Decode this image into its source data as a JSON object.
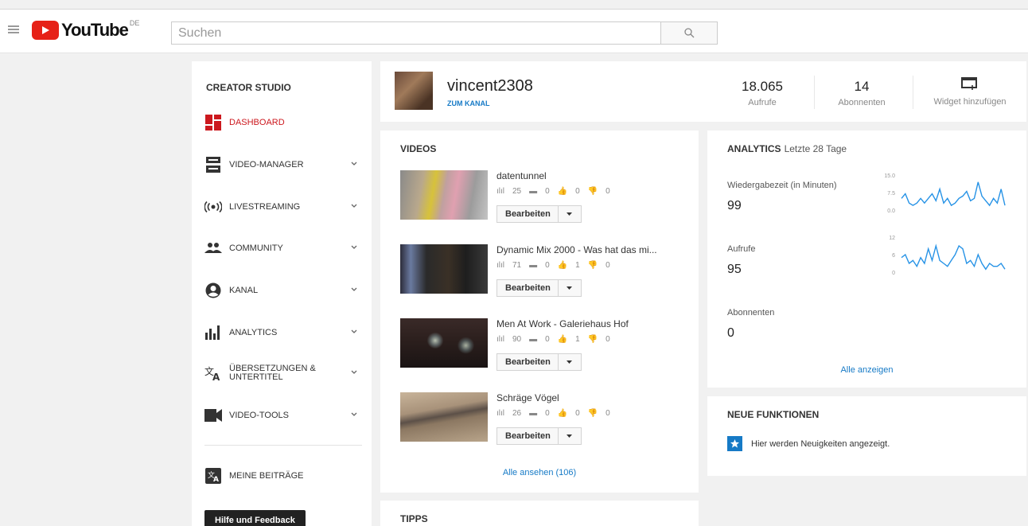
{
  "header": {
    "logo_text": "YouTube",
    "region": "DE",
    "search_placeholder": "Suchen"
  },
  "sidebar": {
    "title": "CREATOR STUDIO",
    "items": [
      {
        "label": "DASHBOARD",
        "icon": "dashboard-icon",
        "active": true
      },
      {
        "label": "VIDEO-MANAGER",
        "icon": "video-manager-icon"
      },
      {
        "label": "LIVESTREAMING",
        "icon": "livestream-icon"
      },
      {
        "label": "COMMUNITY",
        "icon": "community-icon"
      },
      {
        "label": "KANAL",
        "icon": "channel-icon"
      },
      {
        "label": "ANALYTICS",
        "icon": "analytics-icon"
      },
      {
        "label": "ÜBERSETZUNGEN &",
        "label2": "UNTERTITEL",
        "icon": "translate-icon"
      },
      {
        "label": "VIDEO-TOOLS",
        "icon": "video-tools-icon"
      }
    ],
    "contributions_label": "MEINE BEITRÄGE",
    "help_label": "Hilfe und Feedback"
  },
  "channel": {
    "name": "vincent2308",
    "link_label": "ZUM KANAL",
    "stats": [
      {
        "value": "18.065",
        "label": "Aufrufe"
      },
      {
        "value": "14",
        "label": "Abonnenten"
      }
    ],
    "widget_label": "Widget hinzufügen"
  },
  "videos": {
    "title": "VIDEOS",
    "edit_label": "Bearbeiten",
    "items": [
      {
        "title": "datentunnel",
        "views": "25",
        "comments": "0",
        "likes": "0",
        "dislikes": "0"
      },
      {
        "title": "Dynamic Mix 2000 - Was hat das mi...",
        "views": "71",
        "comments": "0",
        "likes": "1",
        "dislikes": "0"
      },
      {
        "title": "Men At Work - Galeriehaus Hof",
        "views": "90",
        "comments": "0",
        "likes": "1",
        "dislikes": "0"
      },
      {
        "title": "Schräge Vögel",
        "views": "26",
        "comments": "0",
        "likes": "0",
        "dislikes": "0"
      }
    ],
    "see_all": "Alle ansehen (106)"
  },
  "tips": {
    "title": "TIPPS"
  },
  "analytics": {
    "title": "ANALYTICS",
    "period": "Letzte 28 Tage",
    "metrics": [
      {
        "label": "Wiedergabezeit (in Minuten)",
        "value": "99",
        "ticks": [
          "15.0",
          "7.5",
          "0.0"
        ],
        "ymax": 15,
        "series": [
          5,
          7,
          3,
          2,
          3,
          5,
          3,
          5,
          7,
          4,
          9,
          3,
          5,
          2,
          3,
          5,
          6,
          8,
          4,
          5,
          12,
          6,
          4,
          2,
          5,
          3,
          9,
          2
        ]
      },
      {
        "label": "Aufrufe",
        "value": "95",
        "ticks": [
          "12",
          "6",
          "0"
        ],
        "ymax": 12,
        "series": [
          5,
          6,
          3,
          4,
          2,
          5,
          3,
          8,
          4,
          9,
          4,
          3,
          2,
          4,
          6,
          9,
          8,
          3,
          4,
          2,
          6,
          3,
          1,
          3,
          2,
          2,
          3,
          1
        ]
      },
      {
        "label": "Abonnenten",
        "value": "0"
      }
    ],
    "link": "Alle anzeigen"
  },
  "news": {
    "title": "NEUE FUNKTIONEN",
    "text": "Hier werden Neuigkeiten angezeigt."
  }
}
